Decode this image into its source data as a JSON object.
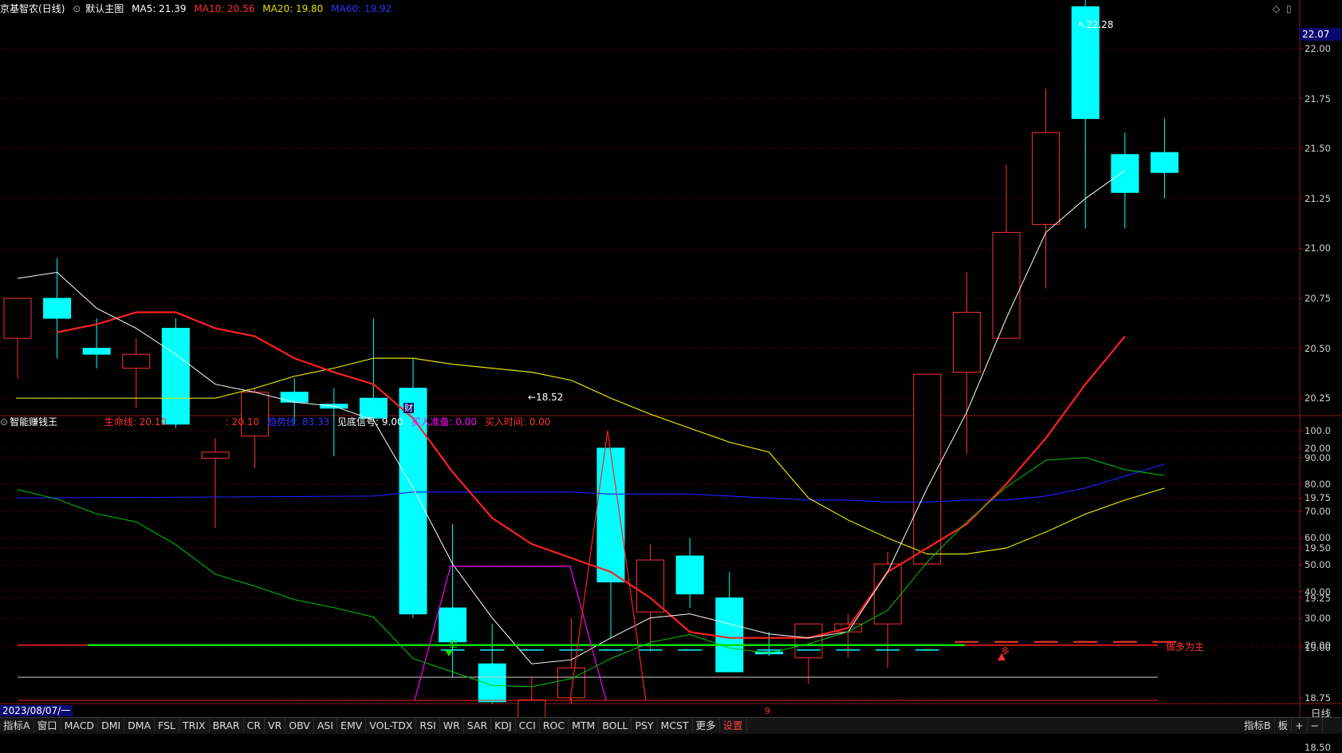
{
  "header": {
    "stock_name": "京基智农",
    "period": "(日线)",
    "main_template": "默认主图",
    "ma5": "MA5: 21.39",
    "ma10": "MA10: 20.56",
    "ma20": "MA20: 19.80",
    "ma60": "MA60: 19.92"
  },
  "sub_header": {
    "indicator_name": "智能赚钱王",
    "lifeline": "生命线: 20.10",
    "lifeline2": ": 20.10",
    "trend": "趋势线: 83.33",
    "bottom_signal": "见底信号: 9.00",
    "buy_prep": "买入准备: 0.00",
    "buy_time": "买入时间: 0.00"
  },
  "colors": {
    "up": "#ff3232",
    "down": "#00ffff",
    "ma5": "#ffffff",
    "ma10": "#ff2020",
    "ma20": "#e0e000",
    "ma60": "#2020ff",
    "trend": "#00c800",
    "magenta": "#ff00ff"
  },
  "price_axis": [
    "22.00",
    "21.75",
    "21.50",
    "21.25",
    "21.00",
    "20.75",
    "20.50",
    "20.25",
    "20.00",
    "19.75",
    "19.50",
    "19.25",
    "19.00",
    "18.75",
    "18.50"
  ],
  "current_price": "22.07",
  "high_label": "22.28",
  "low_label": "18.52",
  "fin_marker": "财",
  "sub_axis": [
    "100.0",
    "90.00",
    "80.00",
    "70.00",
    "60.00",
    "50.00",
    "40.00",
    "30.00",
    "20.00"
  ],
  "sub_labels": {
    "weak_bull": "做多为主",
    "empty_mark": "空",
    "bull_mark": "多"
  },
  "date_label": "2023/08/07/一",
  "month_marker": "9",
  "period_label": "日线",
  "candles": [
    {
      "o": 20.55,
      "h": 20.75,
      "l": 20.35,
      "c": 20.75
    },
    {
      "o": 20.75,
      "h": 20.95,
      "l": 20.45,
      "c": 20.65
    },
    {
      "o": 20.5,
      "h": 20.65,
      "l": 20.4,
      "c": 20.47
    },
    {
      "o": 20.4,
      "h": 20.55,
      "l": 20.2,
      "c": 20.47
    },
    {
      "o": 20.6,
      "h": 20.65,
      "l": 20.1,
      "c": 20.12
    },
    {
      "o": 19.95,
      "h": 20.05,
      "l": 19.6,
      "c": 19.98
    },
    {
      "o": 20.06,
      "h": 20.3,
      "l": 19.9,
      "c": 20.28
    },
    {
      "o": 20.28,
      "h": 20.35,
      "l": 20.12,
      "c": 20.23
    },
    {
      "o": 20.22,
      "h": 20.3,
      "l": 19.96,
      "c": 20.2
    },
    {
      "o": 20.25,
      "h": 20.65,
      "l": 20.15,
      "c": 20.15
    },
    {
      "o": 20.3,
      "h": 20.45,
      "l": 19.15,
      "c": 19.17
    },
    {
      "o": 19.2,
      "h": 19.62,
      "l": 18.85,
      "c": 19.03
    },
    {
      "o": 18.92,
      "h": 19.12,
      "l": 18.72,
      "c": 18.73
    },
    {
      "o": 18.6,
      "h": 18.85,
      "l": 18.52,
      "c": 18.74
    },
    {
      "o": 18.75,
      "h": 19.15,
      "l": 18.72,
      "c": 18.9
    },
    {
      "o": 20.0,
      "h": 20.0,
      "l": 19.05,
      "c": 19.33
    },
    {
      "o": 19.18,
      "h": 19.52,
      "l": 18.98,
      "c": 19.44
    },
    {
      "o": 19.46,
      "h": 19.55,
      "l": 19.2,
      "c": 19.27
    },
    {
      "o": 19.25,
      "h": 19.38,
      "l": 18.88,
      "c": 18.88
    },
    {
      "o": 18.98,
      "h": 19.08,
      "l": 18.96,
      "c": 18.97
    },
    {
      "o": 18.95,
      "h": 19.12,
      "l": 18.82,
      "c": 19.12
    },
    {
      "o": 19.08,
      "h": 19.17,
      "l": 18.95,
      "c": 19.12
    },
    {
      "o": 19.12,
      "h": 19.48,
      "l": 18.9,
      "c": 19.42
    },
    {
      "o": 19.42,
      "h": 20.25,
      "l": 19.42,
      "c": 20.37
    },
    {
      "o": 20.38,
      "h": 20.88,
      "l": 19.97,
      "c": 20.68
    },
    {
      "o": 20.55,
      "h": 21.42,
      "l": 20.55,
      "c": 21.08
    },
    {
      "o": 21.12,
      "h": 21.8,
      "l": 20.8,
      "c": 21.58
    },
    {
      "o": 22.21,
      "h": 22.28,
      "l": 21.1,
      "c": 21.65
    },
    {
      "o": 21.47,
      "h": 21.58,
      "l": 21.1,
      "c": 21.28
    },
    {
      "o": 21.48,
      "h": 21.65,
      "l": 21.25,
      "c": 21.38
    }
  ],
  "ma5": [
    20.85,
    20.88,
    20.7,
    20.6,
    20.47,
    20.32,
    20.28,
    20.23,
    20.21,
    20.14,
    19.8,
    19.42,
    19.15,
    18.92,
    18.94,
    19.05,
    19.15,
    19.17,
    19.12,
    19.07,
    19.05,
    19.08,
    19.38,
    19.8,
    20.18,
    20.65,
    21.08,
    21.25,
    21.39
  ],
  "ma10": [
    20.58,
    20.62,
    20.68,
    20.68,
    20.6,
    20.56,
    20.45,
    20.38,
    20.32,
    20.15,
    19.88,
    19.65,
    19.52,
    19.45,
    19.38,
    19.25,
    19.08,
    19.05,
    19.05,
    19.05,
    19.1,
    19.38,
    19.5,
    19.62,
    19.82,
    20.05,
    20.32,
    20.56
  ],
  "ma20": [
    20.25,
    20.3,
    20.36,
    20.4,
    20.45,
    20.45,
    20.42,
    20.4,
    20.38,
    20.34,
    20.25,
    20.17,
    20.1,
    20.03,
    19.98,
    19.75,
    19.64,
    19.55,
    19.47,
    19.47,
    19.5,
    19.58,
    19.67,
    19.74,
    19.8
  ],
  "ma60": [
    19.76,
    19.78,
    19.78,
    19.78,
    19.78,
    19.78,
    19.77,
    19.77,
    19.77,
    19.76,
    19.75,
    19.74,
    19.74,
    19.73,
    19.73,
    19.74,
    19.74,
    19.76,
    19.8,
    19.86,
    19.92
  ],
  "trend_line": [
    78,
    74.5,
    69,
    66,
    57.5,
    46.5,
    42,
    37,
    34,
    30.5,
    15,
    10,
    5,
    4.5,
    7.5,
    15,
    21,
    24,
    19,
    17,
    20.5,
    25,
    33,
    51,
    66,
    79,
    89,
    90,
    85.5,
    83.3
  ],
  "magenta_line": [
    0,
    0,
    0,
    0,
    0,
    0,
    0,
    0,
    0,
    0,
    0,
    0,
    50.5,
    50.5,
    50.5,
    50.5,
    0,
    0,
    0,
    0,
    0,
    0,
    0,
    0,
    0,
    0,
    0,
    0,
    0,
    0
  ],
  "red_spike": [
    0,
    0,
    0,
    0,
    0,
    0,
    0,
    0,
    0,
    0,
    0,
    0,
    0,
    0,
    0,
    100,
    0,
    0,
    0,
    0,
    0,
    0,
    0,
    0,
    0,
    0,
    0,
    0,
    0,
    0
  ],
  "tabs_left": [
    "指标A",
    "窗口",
    "MACD",
    "DMI",
    "DMA",
    "FSL",
    "TRIX",
    "BRAR",
    "CR",
    "VR",
    "OBV",
    "ASI",
    "EMV",
    "VOL-TDX",
    "RSI",
    "WR",
    "SAR",
    "KDJ",
    "CCI",
    "ROC",
    "MTM",
    "BOLL",
    "PSY",
    "MCST",
    "更多",
    "设置"
  ],
  "tabs_right": [
    "指标B",
    "板",
    "+",
    "−"
  ]
}
